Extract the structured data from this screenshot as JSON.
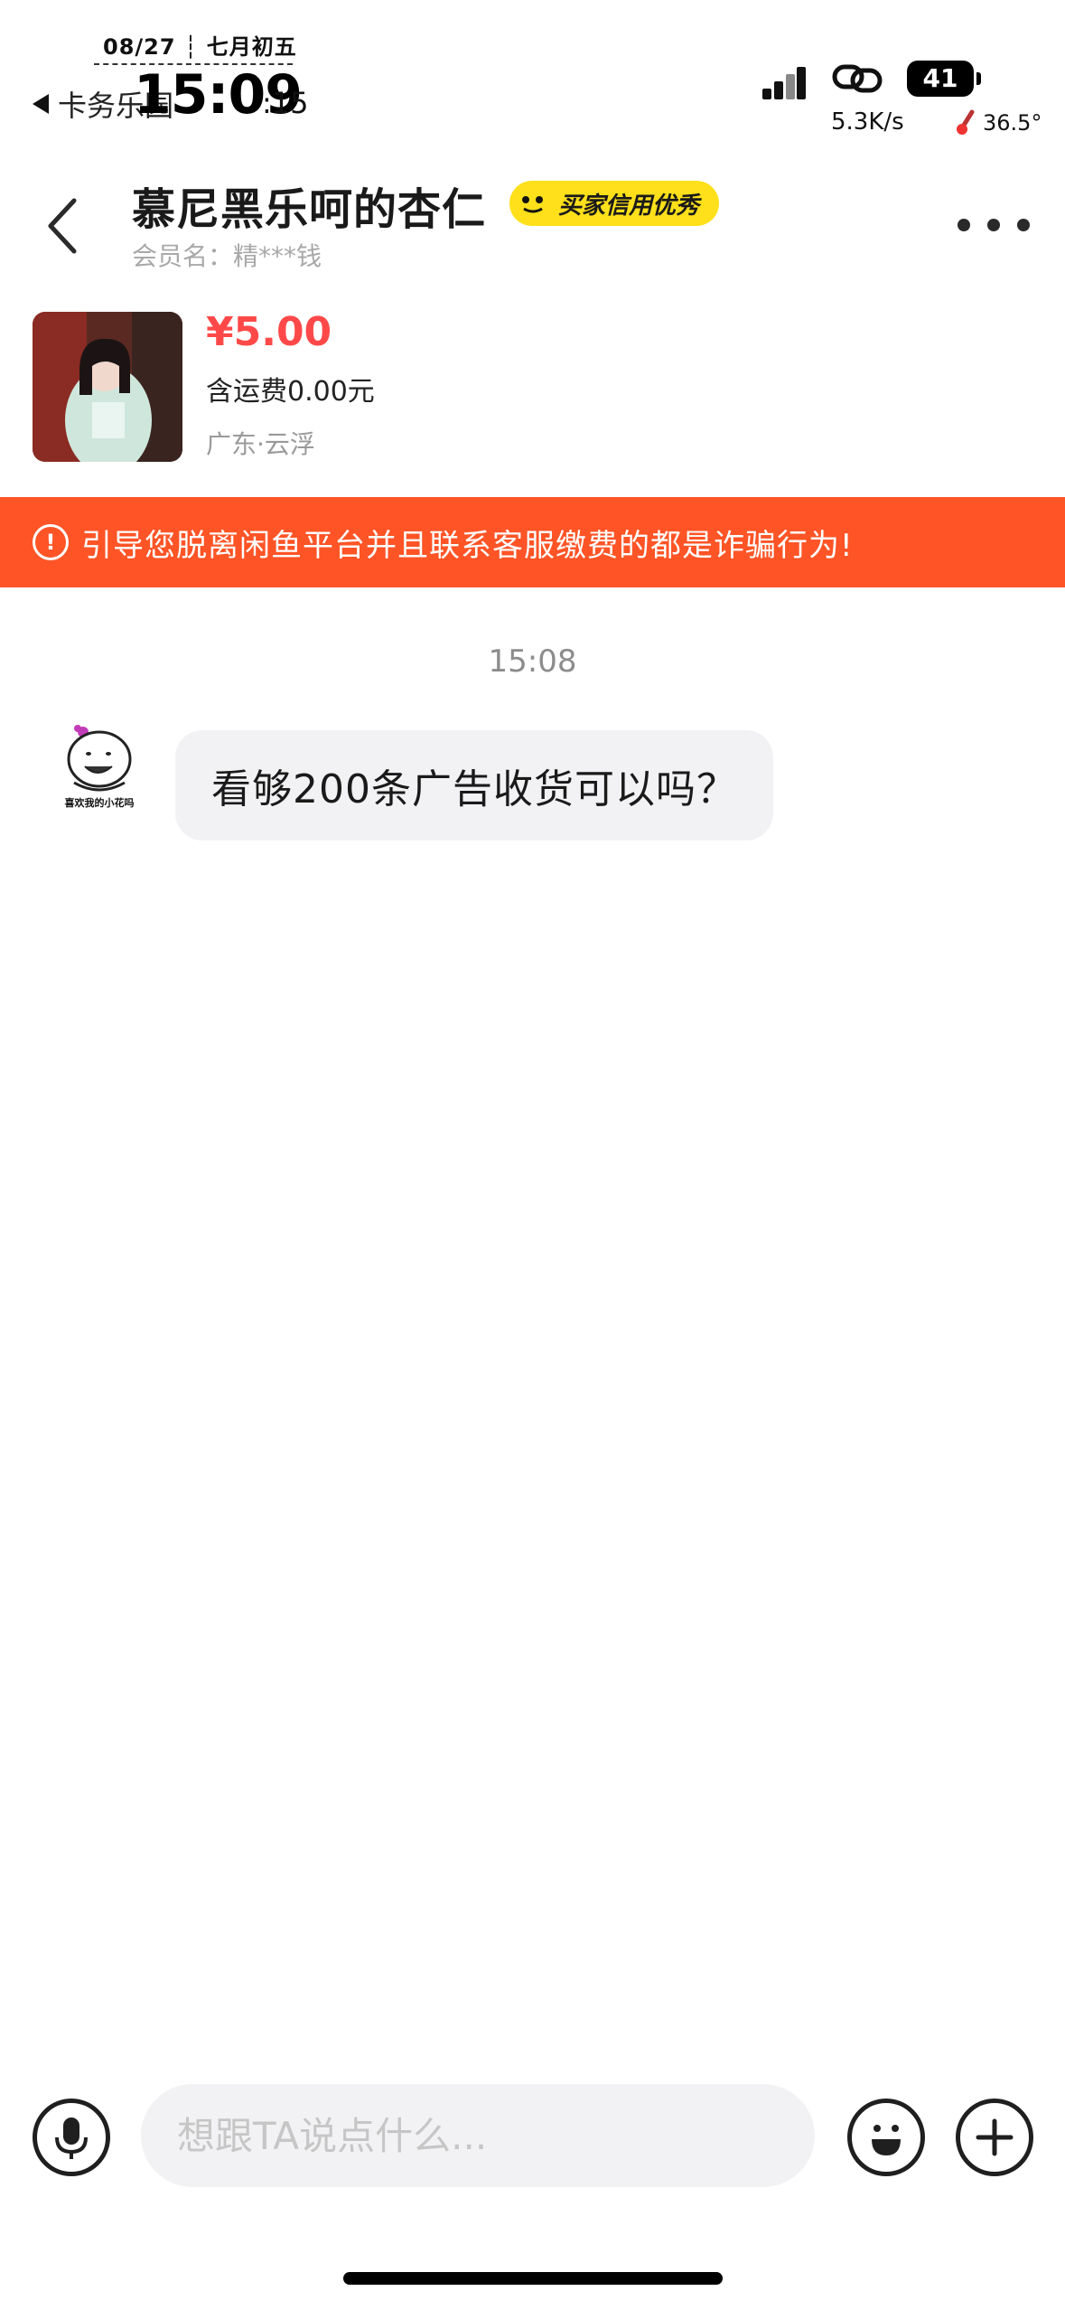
{
  "status_bar": {
    "date": "08/27 ┆ 七月初五",
    "back_label": "卡务乐园",
    "time": "15:09",
    "seconds": ":15",
    "net_speed": "5.3K/s",
    "battery": "41",
    "temperature": "36.5°"
  },
  "header": {
    "title": "慕尼黑乐呵的杏仁",
    "badge": "买家信用优秀",
    "member": "会员名：精***钱"
  },
  "product": {
    "price": "¥5.00",
    "shipping": "含运费0.00元",
    "location": "广东·云浮"
  },
  "warning": {
    "text": "引导您脱离闲鱼平台并且联系客服缴费的都是诈骗行为!"
  },
  "messages": {
    "timestamp": "15:08",
    "avatar_caption": "喜欢我的小花吗",
    "items": [
      {
        "text": "看够200条广告收货可以吗？"
      }
    ]
  },
  "input": {
    "placeholder": "想跟TA说点什么..."
  },
  "colors": {
    "price": "#ff4949",
    "warning_bg": "#ff5426",
    "badge_bg": "#ffe01a",
    "bubble_bg": "#f2f2f4"
  },
  "icons": [
    "back-arrow-icon",
    "more-icon",
    "warning-icon",
    "mic-icon",
    "emoji-icon",
    "plus-icon",
    "signal-icon",
    "link-icon",
    "thermometer-icon"
  ]
}
